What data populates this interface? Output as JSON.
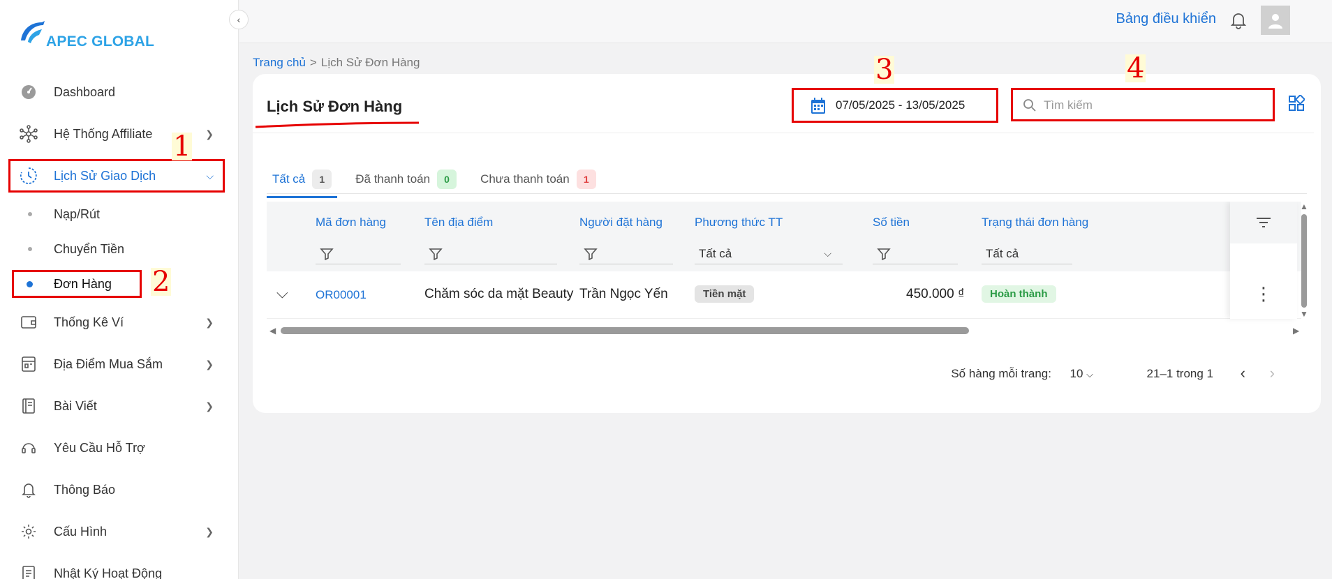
{
  "brand": {
    "logo_text": "APEC GLOBAL"
  },
  "sidebar": {
    "items": [
      {
        "label": "Dashboard",
        "icon": "gauge-icon"
      },
      {
        "label": "Hệ Thống Affiliate",
        "icon": "network-icon"
      },
      {
        "label": "Lịch Sử Giao Dịch",
        "icon": "history-icon"
      },
      {
        "label": "Thống Kê Ví",
        "icon": "wallet-icon"
      },
      {
        "label": "Địa Điểm Mua Sắm",
        "icon": "store-icon"
      },
      {
        "label": "Bài Viết",
        "icon": "notebook-icon"
      },
      {
        "label": "Yêu Cầu Hỗ Trợ",
        "icon": "headset-icon"
      },
      {
        "label": "Thông Báo",
        "icon": "bell-icon"
      },
      {
        "label": "Cấu Hình",
        "icon": "gear-icon"
      },
      {
        "label": "Nhật Ký Hoạt Động",
        "icon": "log-icon"
      }
    ],
    "sub_items": [
      {
        "label": "Nạp/Rút"
      },
      {
        "label": "Chuyển Tiền"
      },
      {
        "label": "Đơn Hàng"
      }
    ]
  },
  "topbar": {
    "dashboard_link": "Bảng điều khiển"
  },
  "breadcrumb": {
    "home": "Trang chủ",
    "separator": ">",
    "current": "Lịch Sử Đơn Hàng"
  },
  "page": {
    "title": "Lịch Sử Đơn Hàng",
    "date_range": "07/05/2025 - 13/05/2025",
    "search_placeholder": "Tìm kiếm"
  },
  "annotations": [
    "1",
    "2",
    "3",
    "4"
  ],
  "tabs": [
    {
      "label": "Tất cả",
      "count": "1",
      "color": "#555555"
    },
    {
      "label": "Đã thanh toán",
      "count": "0",
      "color": "#2a9b45"
    },
    {
      "label": "Chưa thanh toán",
      "count": "1",
      "color": "#e03e3e"
    }
  ],
  "table": {
    "columns": [
      "Mã đơn hàng",
      "Tên địa điểm",
      "Người đặt hàng",
      "Phương thức TT",
      "Số tiền",
      "Trạng thái đơn hàng"
    ],
    "filters": {
      "payment_method": "Tất cả",
      "status": "Tất cả"
    },
    "rows": [
      {
        "order_id": "OR00001",
        "location": "Chăm sóc da mặt Beauty",
        "customer": "Trần Ngọc Yến",
        "payment": "Tiền mặt",
        "amount": "450.000 ₫",
        "status": "Hoàn thành"
      }
    ]
  },
  "pagination": {
    "rows_per_page_label": "Số hàng mỗi trang:",
    "rows_per_page": "10",
    "range": "21–1 trong 1"
  },
  "colors": {
    "accent": "#1e73d6",
    "annotation": "#e60000",
    "logo": "#2ea3e6"
  }
}
